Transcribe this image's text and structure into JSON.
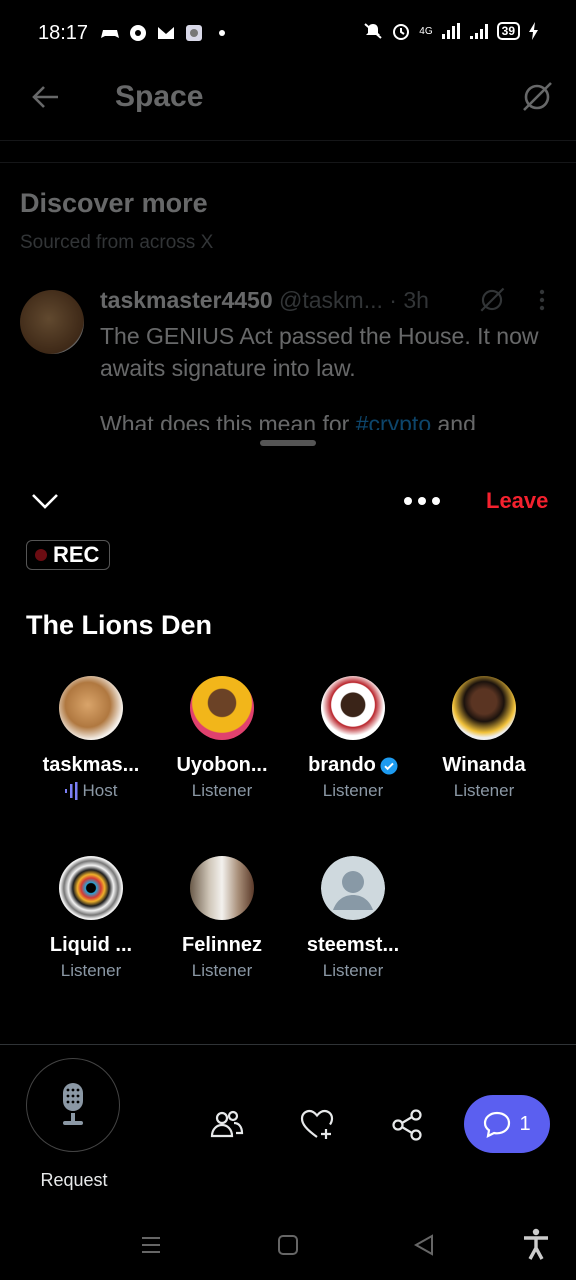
{
  "status_bar": {
    "time": "18:17",
    "network": "4G",
    "battery": "39"
  },
  "header": {
    "title": "Space"
  },
  "discover": {
    "title": "Discover more",
    "subtitle": "Sourced from across X"
  },
  "post": {
    "author_name": "taskmaster4450",
    "author_handle": "@taskm...",
    "time": "· 3h",
    "text": "The GENIUS Act passed the House.  It now awaits signature into law.",
    "text2_before": "What does this mean for ",
    "hashtag": "#crypto",
    "text2_after": " and"
  },
  "sheet": {
    "leave_label": "Leave",
    "rec_label": "REC",
    "space_title": "The Lions Den"
  },
  "participants": [
    {
      "name": "taskmas...",
      "role": "Host"
    },
    {
      "name": "Uyobon...",
      "role": "Listener"
    },
    {
      "name": "brando",
      "role": "Listener"
    },
    {
      "name": "Winanda",
      "role": "Listener"
    },
    {
      "name": "Liquid ...",
      "role": "Listener"
    },
    {
      "name": "Felinnez",
      "role": "Listener"
    },
    {
      "name": "steemst...",
      "role": "Listener"
    }
  ],
  "bottom_bar": {
    "request_label": "Request",
    "chat_count": "1"
  },
  "colors": {
    "leave": "#f4212e",
    "chat_button": "#5b5ff0",
    "hashtag": "#1d9bf0",
    "verified": "#1d9bf0"
  },
  "icons": [
    "back-arrow-icon",
    "grok-icon",
    "more-vertical-icon",
    "chevron-down-icon",
    "more-horizontal-icon",
    "microphone-icon",
    "people-icon",
    "heart-add-icon",
    "share-icon",
    "chat-bubble-icon",
    "verified-icon",
    "speaking-bars-icon"
  ]
}
